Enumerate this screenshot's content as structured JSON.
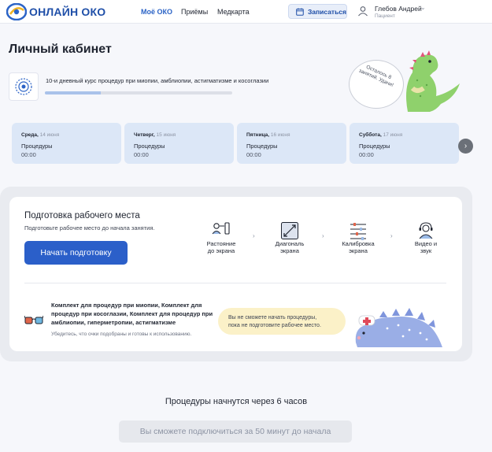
{
  "header": {
    "brand": "ОНЛАЙН ОКО",
    "nav": [
      {
        "label": "Моё ОКО",
        "active": true
      },
      {
        "label": "Приёмы",
        "active": false
      },
      {
        "label": "Медкарта",
        "active": false
      }
    ],
    "book_label": "Записаться",
    "user_name": "Глебов Андрей",
    "user_role": "Пациент"
  },
  "page": {
    "title": "Личный кабинет",
    "course_text": "10-и дневный курс процедур при миопии, амблиопии, астигматизме и косоглазии",
    "course_progress": 0.3,
    "bubble_text": "Осталось 8 занятий. Удачи!"
  },
  "schedule": [
    {
      "day": "Среда,",
      "date": "14 июня",
      "label": "Процедуры",
      "time": "00:00"
    },
    {
      "day": "Четверг,",
      "date": "15 июня",
      "label": "Процедуры",
      "time": "00:00"
    },
    {
      "day": "Пятница,",
      "date": "16 июня",
      "label": "Процедуры",
      "time": "00:00"
    },
    {
      "day": "Суббота,",
      "date": "17 июня",
      "label": "Процедуры",
      "time": "00:00"
    }
  ],
  "prep": {
    "title": "Подготовка рабочего места",
    "subtitle": "Подготовьте рабочее место до начала занятия.",
    "button": "Начать подготовку",
    "steps": [
      {
        "line1": "Растояние",
        "line2": "до экрана",
        "icon": "distance-icon"
      },
      {
        "line1": "Диагональ",
        "line2": "экрана",
        "icon": "diagonal-icon"
      },
      {
        "line1": "Калибровка",
        "line2": "экрана",
        "icon": "calibration-icon"
      },
      {
        "line1": "Видео и",
        "line2": "звук",
        "icon": "video-sound-icon"
      }
    ],
    "kit_text": "Комплект для процедур при миопии, Комплект для процедур при косоглазии, Комплект для процедур при амблиопии, гиперметропии, астигматизме",
    "kit_note": "Убедитесь, что очки подобраны и готовы к использованию.",
    "warning_line1": "Вы не сможете начать процедуры,",
    "warning_line2": "пока не подготовите рабочее место."
  },
  "footer": {
    "countdown": "Процедуры начнутся через 6 часов",
    "connect": "Вы сможете подключиться за 50 минут до начала"
  },
  "colors": {
    "accent": "#2b5fc9",
    "card": "#dce7f7",
    "warning": "#fbf1c8"
  }
}
